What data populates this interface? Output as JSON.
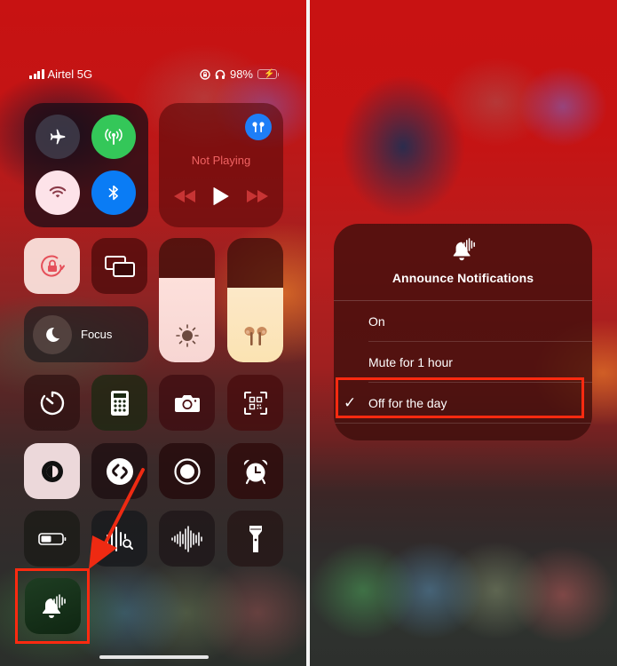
{
  "status_bar": {
    "carrier": "Airtel 5G",
    "battery_percent": "98%",
    "icons": [
      "signal-icon",
      "orientation-lock-icon",
      "headphones-icon",
      "battery-charging-icon"
    ]
  },
  "control_center": {
    "connectivity": [
      {
        "name": "airplane-mode",
        "icon": "airplane-icon",
        "active": false
      },
      {
        "name": "cellular-data",
        "icon": "antenna-icon",
        "active": true,
        "color": "#34c759"
      },
      {
        "name": "wifi",
        "icon": "wifi-icon",
        "active": true,
        "color": "#fde3e9"
      },
      {
        "name": "bluetooth",
        "icon": "bluetooth-icon",
        "active": true,
        "color": "#0a7cf5"
      }
    ],
    "media": {
      "title": "Not Playing",
      "output_device_icon": "airpods-icon",
      "controls": [
        "rewind-icon",
        "play-icon",
        "fast-forward-icon"
      ]
    },
    "screen_orientation_lock": {
      "icon": "orientation-lock-icon",
      "active": true
    },
    "screen_mirroring": {
      "icon": "screen-mirroring-icon"
    },
    "focus": {
      "label": "Focus",
      "icon": "moon-icon"
    },
    "brightness": {
      "icon": "sun-icon",
      "level": 0.68
    },
    "volume": {
      "icon": "airpods-icon",
      "level": 0.6
    },
    "grid_tiles": [
      {
        "name": "timer",
        "icon": "timer-icon"
      },
      {
        "name": "calculator",
        "icon": "calculator-icon"
      },
      {
        "name": "camera",
        "icon": "camera-icon"
      },
      {
        "name": "code-scanner",
        "icon": "qr-code-icon"
      },
      {
        "name": "dark-mode",
        "icon": "dark-mode-icon",
        "active": true
      },
      {
        "name": "shazam",
        "icon": "shazam-icon"
      },
      {
        "name": "screen-recording",
        "icon": "record-icon"
      },
      {
        "name": "alarm",
        "icon": "alarm-clock-icon"
      },
      {
        "name": "low-power-mode",
        "icon": "battery-icon"
      },
      {
        "name": "sound-recognition",
        "icon": "sound-recognition-icon"
      },
      {
        "name": "voice-memos",
        "icon": "waveform-icon"
      },
      {
        "name": "flashlight",
        "icon": "flashlight-icon"
      },
      {
        "name": "announce-notifications",
        "icon": "bell-waveform-icon",
        "highlighted": true
      }
    ]
  },
  "announce_menu": {
    "icon": "bell-waveform-icon",
    "title": "Announce Notifications",
    "items": [
      {
        "label": "On",
        "selected": false
      },
      {
        "label": "Mute for 1 hour",
        "selected": false
      },
      {
        "label": "Off for the day",
        "selected": true,
        "highlighted": true
      }
    ]
  },
  "annotations": {
    "highlight_color": "#ff2a10"
  }
}
